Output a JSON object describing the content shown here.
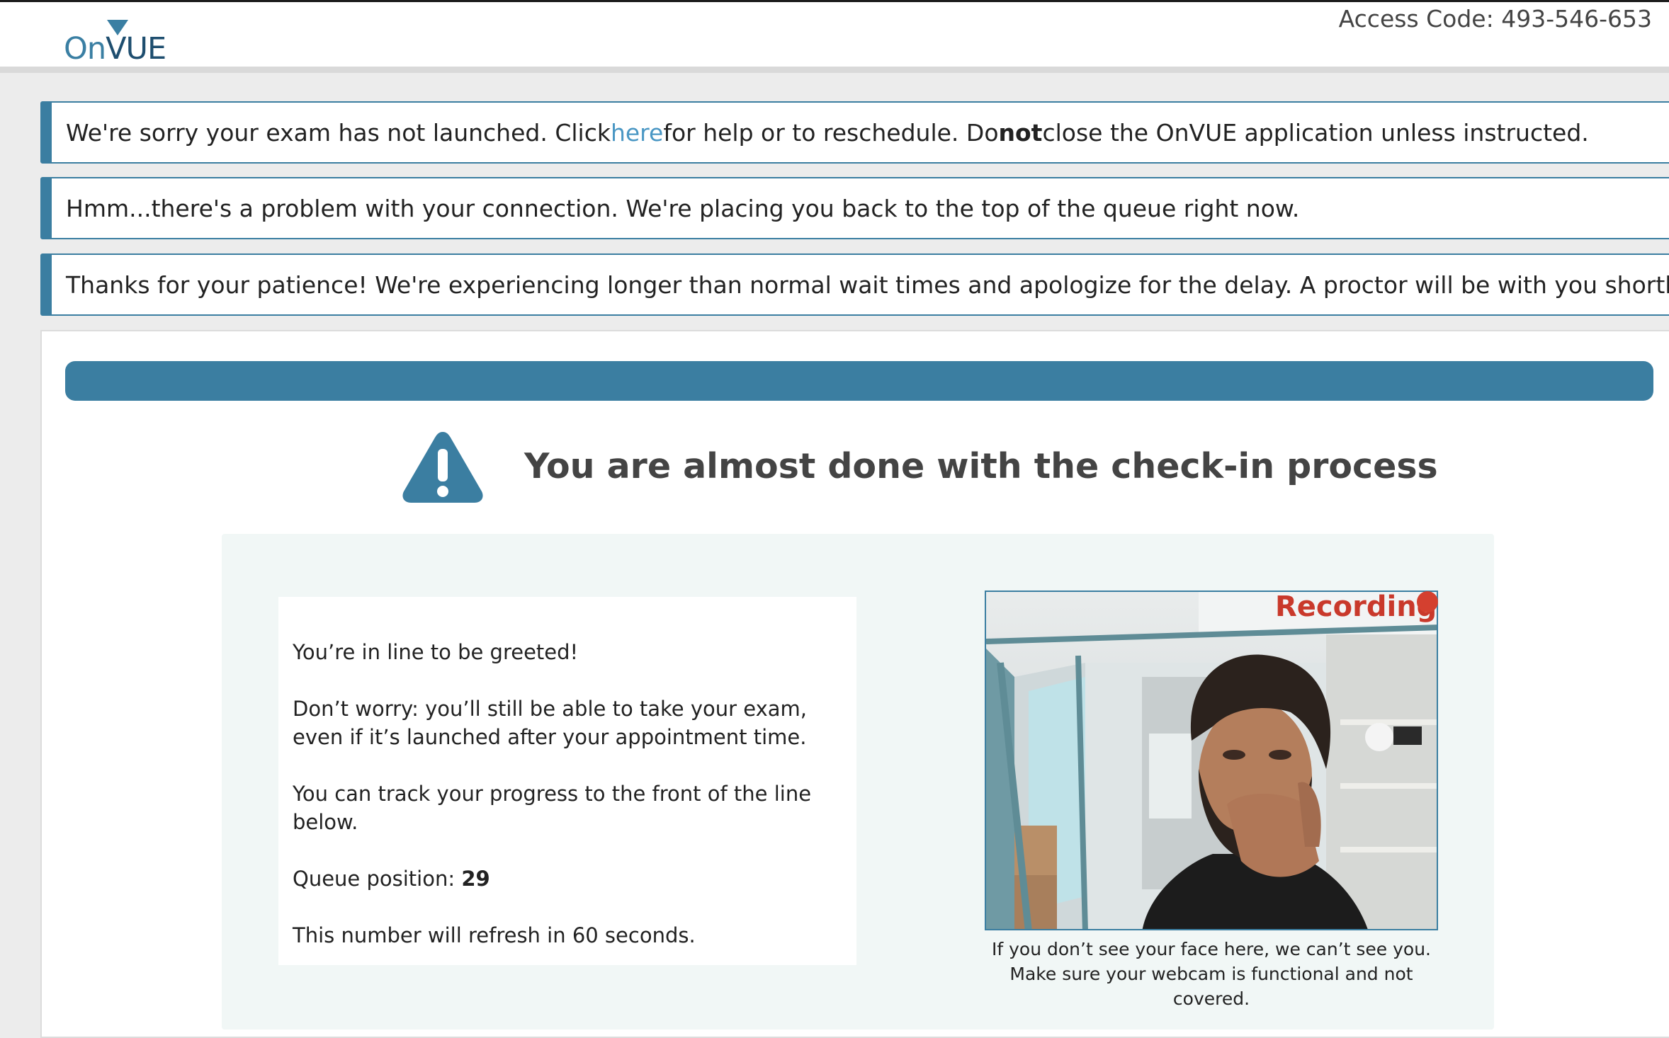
{
  "header": {
    "logo_on": "On",
    "logo_vue": "VUE",
    "access_code_label": "Access Code: 493-546-653"
  },
  "alerts": [
    {
      "part1": "We're sorry your exam has not launched. Click ",
      "link": "here",
      "part2": " for help or to reschedule. Do ",
      "bold": "not",
      "part3": " close the OnVUE application unless instructed."
    },
    {
      "text": "Hmm...there's a problem with your connection. We're placing you back to the top of the queue right now."
    },
    {
      "text": "Thanks for your patience! We're experiencing longer than normal wait times and apologize for the delay. A proctor will be with you shortly."
    }
  ],
  "main": {
    "progress": 1.0,
    "title": "You are almost done with the check-in process",
    "info": {
      "line1": "You’re in line to be greeted!",
      "line2": "Don’t worry: you’ll still be able to take your exam, even if it’s launched after your appointment time.",
      "line3": "You can track your progress to the front of the line below.",
      "queue_label": "Queue position: ",
      "queue_value": "29",
      "line5": "This number will refresh in 60 seconds."
    },
    "webcam": {
      "recording_label": "Recording",
      "caption": "If you don’t see your face here, we can’t see you. Make sure your webcam is functional and not covered."
    }
  },
  "colors": {
    "brand": "#3b7ea1",
    "link": "#4a97c4",
    "recording": "#c9392b"
  },
  "icons": [
    "warning-icon",
    "recording-dot-icon"
  ]
}
